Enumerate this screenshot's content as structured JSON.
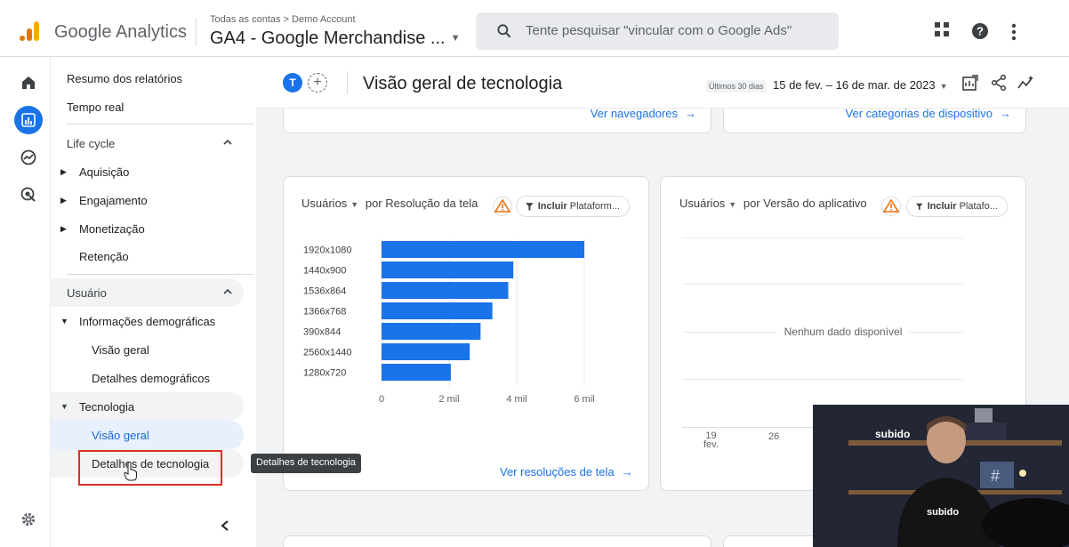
{
  "app": {
    "product_name": "Google Analytics",
    "breadcrumb": "Todas as contas > Demo Account",
    "property_name": "GA4 - Google Merchandise ..."
  },
  "search": {
    "placeholder": "Tente pesquisar \"vincular com o Google Ads\""
  },
  "nav": {
    "items_top": [
      "Resumo dos relatórios",
      "Tempo real"
    ],
    "lifecycle": {
      "label": "Life cycle",
      "items": [
        "Aquisição",
        "Engajamento",
        "Monetização",
        "Retenção"
      ]
    },
    "user": {
      "label": "Usuário",
      "demographics": {
        "label": "Informações demográficas",
        "items": [
          "Visão geral",
          "Detalhes demográficos"
        ]
      },
      "technology": {
        "label": "Tecnologia",
        "items": [
          "Visão geral",
          "Detalhes de tecnologia"
        ]
      }
    }
  },
  "header": {
    "avatar_letter": "T",
    "title": "Visão geral de tecnologia",
    "date_range_label": "Últimos 30 dias",
    "date_range": "15 de fev. – 16 de mar. de 2023"
  },
  "top_cards": {
    "left_link": "Ver navegadores",
    "right_link": "Ver categorias de dispositivo"
  },
  "resolution_card": {
    "metric": "Usuários",
    "dimension": "por Resolução da tela",
    "filter_label": "Incluir",
    "filter_value": "Plataform...",
    "link": "Ver resoluções de tela"
  },
  "app_version_card": {
    "metric": "Usuários",
    "dimension": "por Versão do aplicativo",
    "filter_label": "Incluir",
    "filter_value": "Platafo...",
    "no_data": "Nenhum dado disponível",
    "x_ticks": [
      {
        "day": "19",
        "month": "fev."
      },
      {
        "day": "26",
        "month": ""
      }
    ]
  },
  "chart_data": {
    "type": "bar",
    "orientation": "horizontal",
    "categories": [
      "1920x1080",
      "1440x900",
      "1536x864",
      "1366x768",
      "390x844",
      "2560x1440",
      "1280x720"
    ],
    "values": [
      6000,
      3900,
      3750,
      3280,
      2930,
      2610,
      2050
    ],
    "x_ticks": [
      "0",
      "2 mil",
      "4 mil",
      "6 mil"
    ],
    "xlim": [
      0,
      6000
    ],
    "grid": true,
    "color": "#1a73e8"
  },
  "tooltip": "Detalhes de tecnologia",
  "webcam": {
    "brand": "subido"
  },
  "colors": {
    "accent": "#1a73e8",
    "highlight": "#d93025"
  }
}
